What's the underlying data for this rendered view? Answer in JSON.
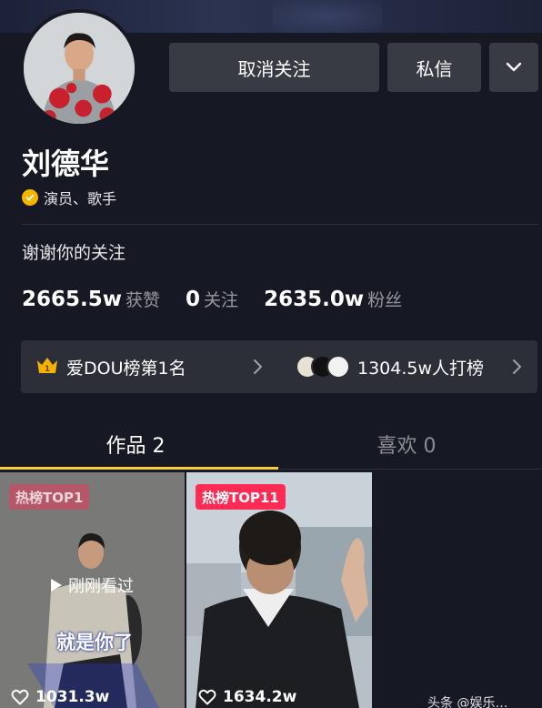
{
  "profile": {
    "name": "刘德华",
    "verification": "演员、歌手",
    "signature": "谢谢你的关注"
  },
  "actions": {
    "unfollow_label": "取消关注",
    "message_label": "私信",
    "more_icon": "chevron-down-icon"
  },
  "stats": [
    {
      "value": "2665.5w",
      "label": "获赞"
    },
    {
      "value": "0",
      "label": "关注"
    },
    {
      "value": "2635.0w",
      "label": "粉丝"
    }
  ],
  "rank": {
    "left_label": "爱DOU榜第1名",
    "right_label": "1304.5w人打榜",
    "crown_number": "1"
  },
  "tabs": [
    {
      "label": "作品 2",
      "active": true
    },
    {
      "label": "喜欢 0",
      "active": false
    }
  ],
  "videos": [
    {
      "tag": "热榜TOP1",
      "overlay": "刚刚看过",
      "caption": "就是你了",
      "likes": "1031.3w"
    },
    {
      "tag": "热榜TOP11",
      "likes": "1634.2w"
    }
  ],
  "watermark": "头条 @娱乐…",
  "colors": {
    "background": "#161823",
    "button": "#393b44",
    "accent": "#facc37",
    "hot_tag": "#fe2c55",
    "verify_badge": "#f7b500"
  }
}
